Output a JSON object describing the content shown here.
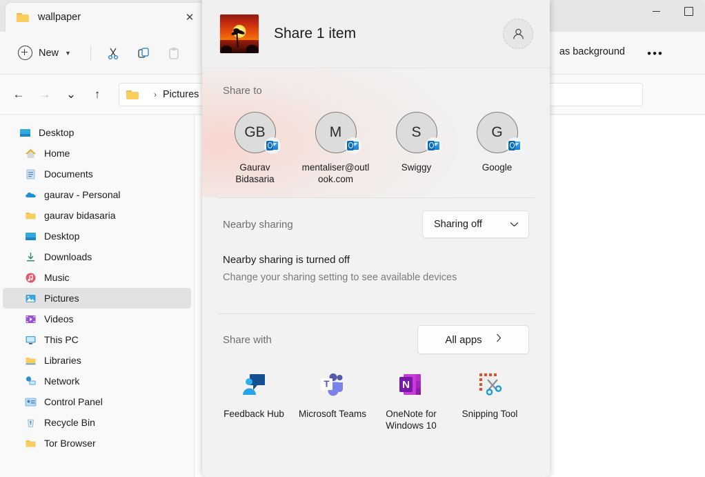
{
  "explorer": {
    "tab": {
      "title": "wallpaper",
      "folder_icon": "folder-icon",
      "close_icon": "close-icon"
    },
    "window_controls": {
      "minimize": "minimize-icon",
      "maximize": "maximize-icon"
    },
    "toolbar": {
      "new_label": "New",
      "new_chevron": "chevron-down-icon",
      "cut_icon": "cut-icon",
      "copy_icon": "copy-icon",
      "paste_icon": "paste-icon",
      "right_text": "as background",
      "overflow": "•••"
    },
    "nav": {
      "back": "←",
      "forward": "→",
      "recent": "⌄",
      "up": "↑",
      "breadcrumb": [
        "Pictures"
      ],
      "separator": "›"
    },
    "sidebar": {
      "items": [
        {
          "label": "Desktop",
          "icon": "desktop-icon",
          "sub": false,
          "selected": false
        },
        {
          "label": "Home",
          "icon": "home-icon",
          "sub": true,
          "selected": false
        },
        {
          "label": "Documents",
          "icon": "documents-icon",
          "sub": true,
          "selected": false
        },
        {
          "label": "gaurav - Personal",
          "icon": "onedrive-icon",
          "sub": true,
          "selected": false
        },
        {
          "label": "gaurav bidasaria",
          "icon": "folder-icon",
          "sub": true,
          "selected": false
        },
        {
          "label": "Desktop",
          "icon": "desktop-icon",
          "sub": true,
          "selected": false
        },
        {
          "label": "Downloads",
          "icon": "downloads-icon",
          "sub": true,
          "selected": false
        },
        {
          "label": "Music",
          "icon": "music-icon",
          "sub": true,
          "selected": false
        },
        {
          "label": "Pictures",
          "icon": "pictures-icon",
          "sub": true,
          "selected": true
        },
        {
          "label": "Videos",
          "icon": "videos-icon",
          "sub": true,
          "selected": false
        },
        {
          "label": "This PC",
          "icon": "thispc-icon",
          "sub": true,
          "selected": false
        },
        {
          "label": "Libraries",
          "icon": "folder-icon",
          "sub": true,
          "selected": false
        },
        {
          "label": "Network",
          "icon": "network-icon",
          "sub": true,
          "selected": false
        },
        {
          "label": "Control Panel",
          "icon": "control-panel-icon",
          "sub": true,
          "selected": false
        },
        {
          "label": "Recycle Bin",
          "icon": "recycle-bin-icon",
          "sub": true,
          "selected": false
        },
        {
          "label": "Tor Browser",
          "icon": "folder-icon",
          "sub": true,
          "selected": false
        }
      ]
    }
  },
  "share_dialog": {
    "header": {
      "title": "Share 1 item",
      "thumbnail": "sunset-image-thumbnail",
      "account_icon": "account-avatar-icon"
    },
    "share_to": {
      "label": "Share to",
      "contacts": [
        {
          "initials": "GB",
          "name": "Gaurav Bidasaria",
          "badge": "outlook-icon"
        },
        {
          "initials": "M",
          "name": "mentaliser@outlook.com",
          "badge": "outlook-icon"
        },
        {
          "initials": "S",
          "name": "Swiggy",
          "badge": "outlook-icon"
        },
        {
          "initials": "G",
          "name": "Google",
          "badge": "outlook-icon"
        }
      ]
    },
    "nearby_sharing": {
      "label": "Nearby sharing",
      "select_value": "Sharing off",
      "select_chevron": "chevron-down-icon",
      "status_title": "Nearby sharing is turned off",
      "status_sub": "Change your sharing setting to see available devices"
    },
    "share_with": {
      "label": "Share with",
      "all_apps_label": "All apps",
      "all_apps_chevron": "chevron-right-icon",
      "apps": [
        {
          "name": "Feedback Hub",
          "icon": "feedback-hub-icon"
        },
        {
          "name": "Microsoft Teams",
          "icon": "microsoft-teams-icon"
        },
        {
          "name": "OneNote for Windows 10",
          "icon": "onenote-icon"
        },
        {
          "name": "Snipping Tool",
          "icon": "snipping-tool-icon"
        }
      ]
    }
  },
  "colors": {
    "accent": "#0f6cbd",
    "dialog_bg": "#f2f2f2",
    "explorer_bg": "#f7f7f7",
    "selected_row": "#e2e2e2",
    "teams_purple": "#6264a7",
    "onenote_purple": "#7719aa",
    "feedback_blue": "#0f7bc4",
    "snip_orange": "#e04e2a"
  }
}
